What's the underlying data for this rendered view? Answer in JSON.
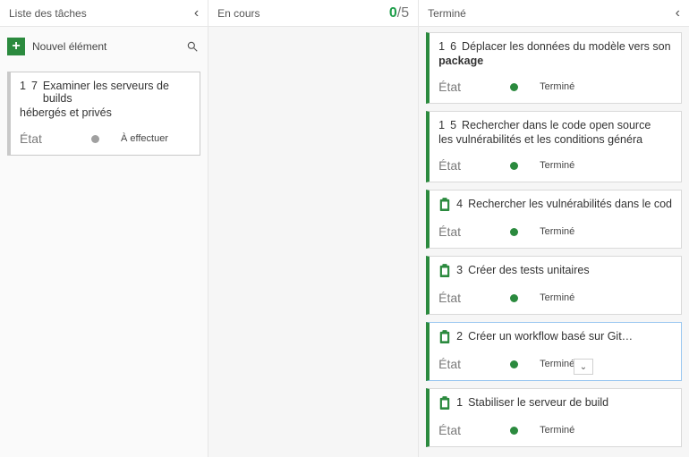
{
  "columns": {
    "todo": {
      "title": "Liste des tâches",
      "newItemLabel": "Nouvel élément"
    },
    "inprogress": {
      "title": "En cours",
      "count_done": "0",
      "count_total": "/5"
    },
    "done": {
      "title": "Terminé"
    }
  },
  "labels": {
    "state": "État",
    "state_todo": "À effectuer",
    "state_done": "Terminé"
  },
  "todo_card": {
    "idx1": "1",
    "idx2": "7",
    "title": "Examiner les serveurs de builds",
    "title2": "hébergés et privés"
  },
  "done_cards": {
    "c0": {
      "idx1": "1",
      "idx2": "6",
      "title": "Déplacer les données du modèle vers son",
      "bold": "package"
    },
    "c1": {
      "idx1": "1",
      "idx2": "5",
      "title": "Rechercher dans le code open source",
      "sub": "les vulnérabilités et les conditions généra"
    },
    "c2": {
      "idx2": "4",
      "title": "Rechercher les vulnérabilités dans le cod"
    },
    "c3": {
      "idx2": "3",
      "title": "Créer des tests unitaires"
    },
    "c4": {
      "idx2": "2",
      "title": "Créer un workflow basé sur Git…"
    },
    "c5": {
      "idx2": "1",
      "title": "Stabiliser le serveur de build"
    }
  }
}
